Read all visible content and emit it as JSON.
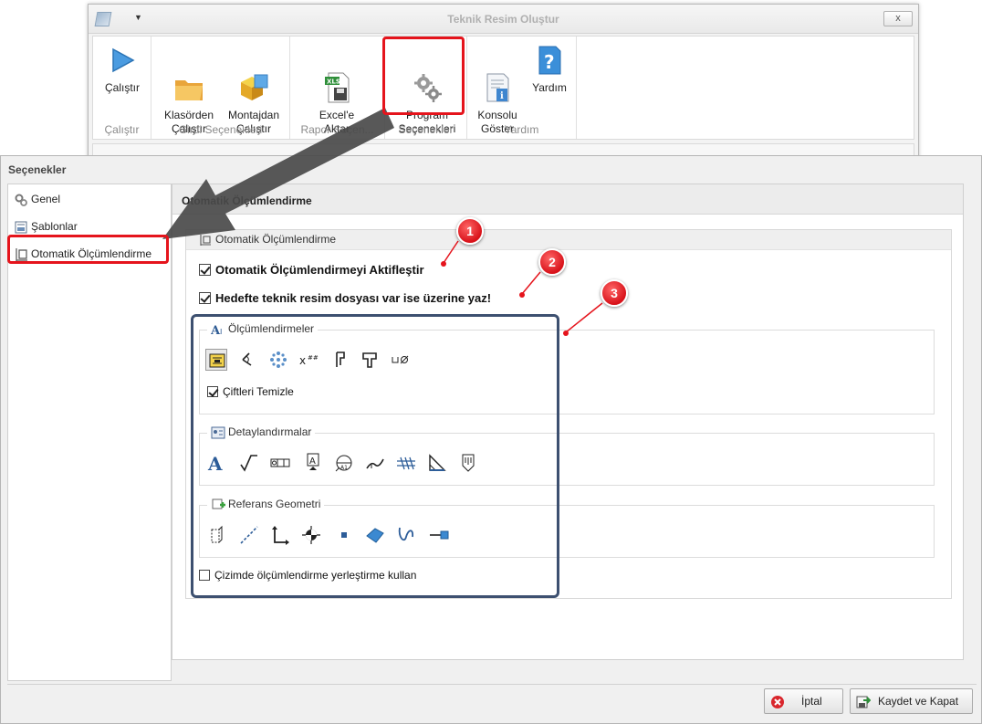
{
  "ribbon": {
    "title": "Teknik Resim Oluştur",
    "close_label": "x",
    "groups": {
      "run": {
        "caption": "Çalıştır",
        "run_label": "Çalıştır"
      },
      "input": {
        "caption": "Girdi Seçenekleri",
        "folder_label": "Klasörden\nÇalıştır",
        "assembly_label": "Montajdan\nÇalıştır"
      },
      "report": {
        "caption": "Rapor Seçen...",
        "excel_label": "Excel'e\nAktar"
      },
      "options": {
        "caption": "Seçenekler",
        "program_options_label": "Program\nSeçenekleri"
      },
      "help": {
        "caption": "Yardım",
        "console_label": "Konsolu\nGöster",
        "help_label": "Yardım"
      }
    }
  },
  "dialog": {
    "title": "Seçenekler",
    "nav": [
      {
        "label": "Genel"
      },
      {
        "label": "Şablonlar"
      },
      {
        "label": "Otomatik Ölçümlendirme"
      }
    ],
    "content_title": "Otomatik Ölçümlendirme",
    "panel_title": "Otomatik Ölçümlendirme",
    "check_enable": {
      "label": "Otomatik Ölçümlendirmeyi Aktifleştir",
      "checked": true
    },
    "check_overwrite": {
      "label": "Hedefte teknik resim dosyası var ise üzerine yaz!",
      "checked": true
    },
    "dimensions_group": {
      "title": "Ölçümlendirmeler",
      "check_clean_pairs": {
        "label": "Çiftleri Temizle",
        "checked": true
      }
    },
    "details_group": {
      "title": "Detaylandırmalar"
    },
    "reference_group": {
      "title": "Referans Geometri"
    },
    "check_placement": {
      "label": "Çizimde ölçümlendirme yerleştirme kullan",
      "checked": false
    },
    "buttons": {
      "cancel": "İptal",
      "save_close": "Kaydet ve Kapat"
    }
  },
  "annotations": {
    "badge1": "1",
    "badge2": "2",
    "badge3": "3"
  },
  "colors": {
    "highlight_red": "#e5141c",
    "highlight_blue": "#3d5070",
    "ribbon_icon_blue": "#3a8fd8"
  }
}
